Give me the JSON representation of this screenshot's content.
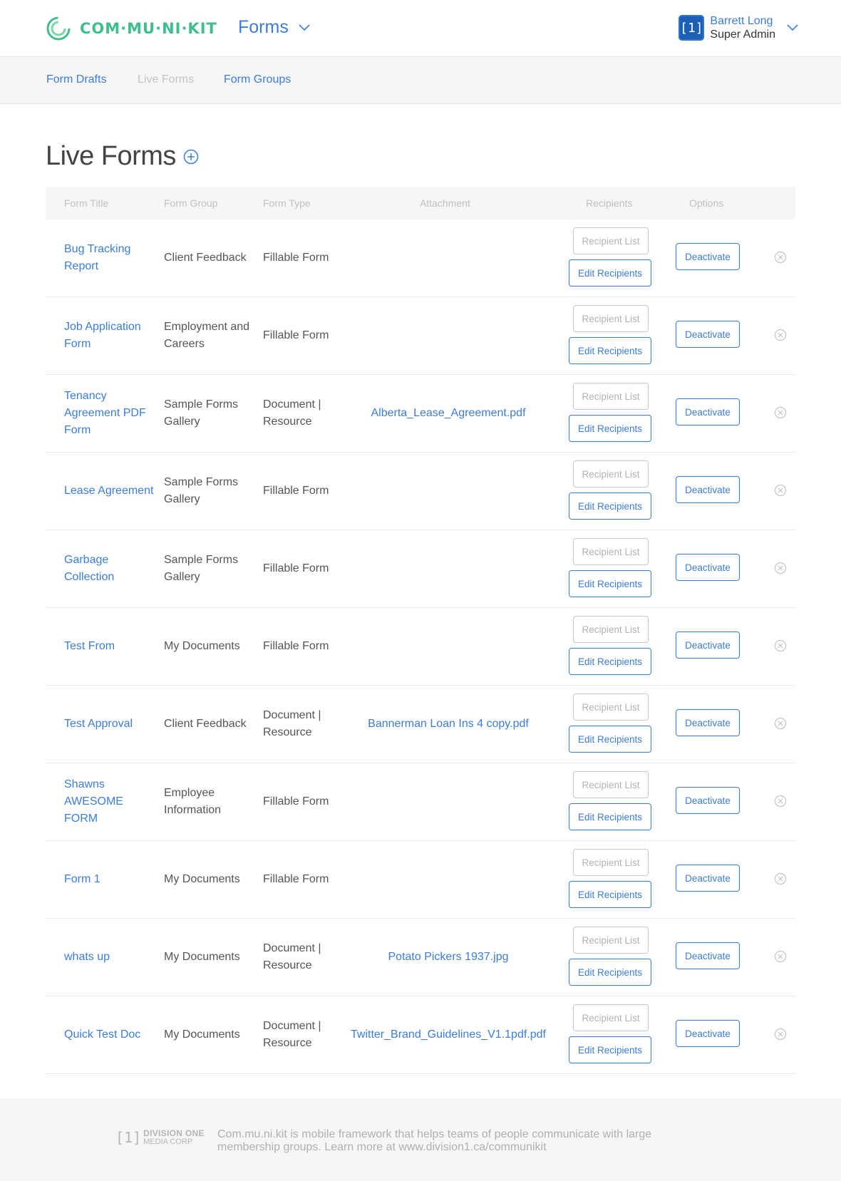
{
  "header": {
    "logo_text": "COM·MU·NI·KIT",
    "section": "Forms",
    "user": {
      "avatar": "[1]",
      "name": "Barrett Long",
      "role": "Super Admin"
    }
  },
  "subnav": {
    "items": [
      {
        "label": "Form Drafts",
        "active": false
      },
      {
        "label": "Live Forms",
        "active": true
      },
      {
        "label": "Form Groups",
        "active": false
      }
    ]
  },
  "page": {
    "title": "Live Forms"
  },
  "table": {
    "columns": [
      "Form Title",
      "Form Group",
      "Form Type",
      "Attachment",
      "Recipients",
      "Options"
    ],
    "recipient_list_label": "Recipient List",
    "edit_recipients_label": "Edit Recipients",
    "deactivate_label": "Deactivate",
    "rows": [
      {
        "title": "Bug Tracking Report",
        "group": "Client Feedback",
        "type": "Fillable Form",
        "attachment": ""
      },
      {
        "title": "Job Application Form",
        "group": "Employment and Careers",
        "type": "Fillable Form",
        "attachment": ""
      },
      {
        "title": "Tenancy Agreement PDF Form",
        "group": "Sample Forms Gallery",
        "type": "Document | Resource",
        "attachment": "Alberta_Lease_Agreement.pdf"
      },
      {
        "title": "Lease Agreement",
        "group": "Sample Forms Gallery",
        "type": "Fillable Form",
        "attachment": ""
      },
      {
        "title": "Garbage Collection",
        "group": "Sample Forms Gallery",
        "type": "Fillable Form",
        "attachment": ""
      },
      {
        "title": "Test From",
        "group": "My Documents",
        "type": "Fillable Form",
        "attachment": ""
      },
      {
        "title": "Test Approval",
        "group": "Client Feedback",
        "type": "Document | Resource",
        "attachment": "Bannerman Loan Ins 4 copy.pdf"
      },
      {
        "title": "Shawns AWESOME FORM",
        "group": "Employee Information",
        "type": "Fillable Form",
        "attachment": ""
      },
      {
        "title": "Form 1",
        "group": "My Documents",
        "type": "Fillable Form",
        "attachment": ""
      },
      {
        "title": "whats up",
        "group": "My Documents",
        "type": "Document | Resource",
        "attachment": "Potato Pickers 1937.jpg"
      },
      {
        "title": "Quick Test Doc",
        "group": "My Documents",
        "type": "Document | Resource",
        "attachment": "Twitter_Brand_Guidelines_V1.1pdf.pdf"
      }
    ]
  },
  "footer": {
    "logo_bracket": "[1]",
    "logo_line1": "DIVISION ONE",
    "logo_line2": "MEDIA CORP",
    "text": "Com.mu.ni.kit is mobile framework that helps teams of people communicate with large membership groups. Learn more at www.division1.ca/communikit"
  },
  "icons": {
    "logo": "communikit-logo-icon",
    "dropdown": "chevron-down-icon",
    "add": "plus-circle-icon",
    "remove": "close-circle-icon"
  },
  "colors": {
    "link": "#3b7ddd",
    "logo_green": "#3dbf8e",
    "muted": "#c0c0c0"
  }
}
